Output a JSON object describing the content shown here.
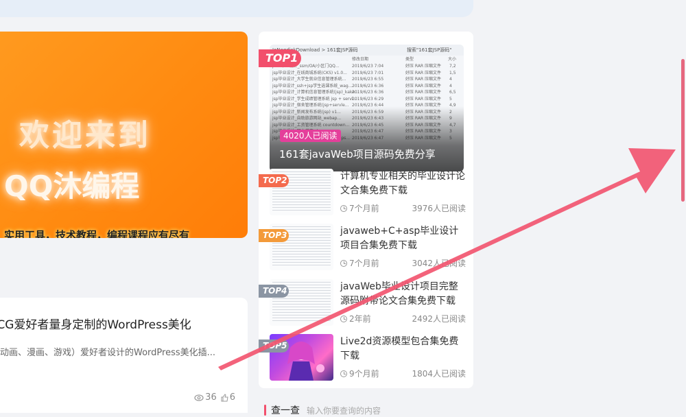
{
  "banner": {
    "line1": "欢迎来到",
    "line2": "QQ沐编程",
    "line3": "实用工具，技术教程，编程课程应有尽有"
  },
  "post": {
    "title": "ACG爱好者量身定制的WordPress美化",
    "desc": "动画、漫画、游戏）爱好者设计的WordPress美化插...",
    "views": "36",
    "likes": "6"
  },
  "ranking": {
    "top1": {
      "badge": "TOP1",
      "reads": "4020人已阅读",
      "title": "161套javaWeb项目源码免费分享",
      "shot_path": "JeNegdiskDownload > 161套JSP源码",
      "shot_search": "搜索\"161套JSP源码\"",
      "shot_cols": [
        "修改日期",
        "类型",
        "大小"
      ],
      "shot_rows": [
        [
          "java毕业设计_ssm/OA/小区门QQ...",
          "2019/6/23 7:04",
          "好压 RAR 压缩文件",
          "7,2"
        ],
        [
          "jsp毕业设计_在线商城系统(CKS) v1.0...",
          "2019/6/23 7:01",
          "好压 RAR 压缩文件",
          "1,5"
        ],
        [
          "jsp毕业设计_大学生就业信息管理系统...",
          "2019/6/23 6:55",
          "好压 RAR 压缩文件",
          "4"
        ],
        [
          "jsp毕业设计_ssh+jsp学生选课系统_wag...",
          "2019/6/23 6:36",
          "好压 RAR 压缩文件",
          "4"
        ],
        [
          "jsp毕业设计_计算机信息管理系统(jsp)_kake...",
          "2019/6/23 6:36",
          "好压 RAR 压缩文件",
          "6,5"
        ],
        [
          "jsp毕业设计_学生成绩管理系统 jsp + servl...",
          "2019/6/23 6:29",
          "好压 RAR 压缩文件",
          "5"
        ],
        [
          "jsp毕业设计_宿舍管理系统(jsp+servle...",
          "2019/6/23 6:44",
          "好压 RAR 压缩文件",
          "4,9"
        ],
        [
          "jsp毕业设计_新闻发布系统(jsp) v1...",
          "2019/6/23 6:59",
          "好压 RAR 压缩文件",
          "2"
        ],
        [
          "jsp毕业设计_自助旅游网站_webap...",
          "2019/6/23 6:43",
          "好压 RAR 压缩文件",
          "9"
        ],
        [
          "jsp毕业设计_工资管理系统 countdown...",
          "2019/6/23 6:45",
          "好压 RAR 压缩文件",
          "4,7"
        ],
        [
          "jsp毕业设计_网上书店 sks...",
          "2019/6/23 6:47",
          "好压 RAR 压缩文件",
          "3"
        ],
        [
          "jsp毕业设计_ssh学生信息管理系统 jsps...",
          "2019/6/23 6:47",
          "好压 RAR 压缩文件",
          "5"
        ]
      ]
    },
    "items": [
      {
        "badge": "TOP2",
        "title": "计算机专业相关的毕业设计论文合集免费下载",
        "time": "7个月前",
        "reads": "3976人已阅读",
        "color": "#f46b4e"
      },
      {
        "badge": "TOP3",
        "title": "javaweb+C+asp毕业设计项目合集免费下载",
        "time": "7个月前",
        "reads": "3042人已阅读",
        "color": "#f39a3a"
      },
      {
        "badge": "TOP4",
        "title": "javaWeb毕业设计项目完整源码附带论文合集免费下载",
        "time": "2年前",
        "reads": "2492人已阅读",
        "color": "#8b95a3"
      },
      {
        "badge": "TOP5",
        "title": "Live2d资源模型包合集免费下载",
        "time": "9个月前",
        "reads": "1804人已阅读",
        "color": "#8b95a3"
      }
    ]
  },
  "search": {
    "label": "查一查",
    "placeholder": "输入你要查询的内容"
  },
  "colors": {
    "accent": "#f24f6c",
    "banner": "#ff8a10",
    "arrow": "#f25670"
  }
}
